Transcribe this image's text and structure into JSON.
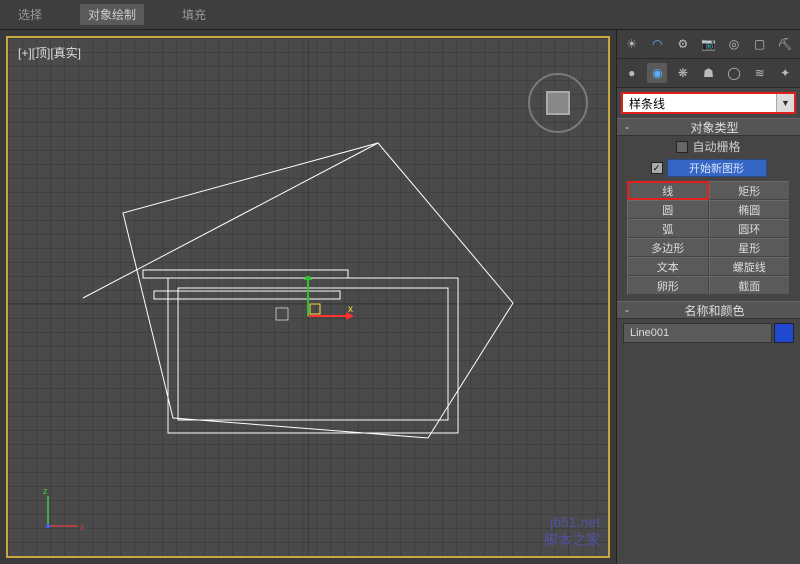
{
  "topMenu": {
    "items": [
      "选择",
      "对象绘制",
      "填充"
    ]
  },
  "viewport": {
    "label": "[+][顶][真实]"
  },
  "rightPanel": {
    "iconRow1": [
      "sun-icon",
      "arc-icon",
      "light-icon",
      "camera-icon",
      "target-icon",
      "screen-icon",
      "pick-icon"
    ],
    "iconRow2": [
      "sphere-icon",
      "shapes-icon",
      "spray-icon",
      "deform-icon",
      "ring-icon",
      "wave-icon",
      "star-icon"
    ],
    "dropdown": {
      "value": "样条线"
    },
    "objectType": {
      "header": "对象类型",
      "autoGrid": "自动栅格",
      "startNewShape": "开始新图形",
      "buttons": [
        [
          "线",
          "矩形"
        ],
        [
          "圆",
          "椭圆"
        ],
        [
          "弧",
          "圆环"
        ],
        [
          "多边形",
          "星形"
        ],
        [
          "文本",
          "螺旋线"
        ],
        [
          "卵形",
          "截面"
        ]
      ],
      "highlight": "线"
    },
    "nameColor": {
      "header": "名称和颜色",
      "name": "Line001"
    }
  },
  "watermark": {
    "line1": "jb51.net",
    "line2": "脚本之家"
  }
}
